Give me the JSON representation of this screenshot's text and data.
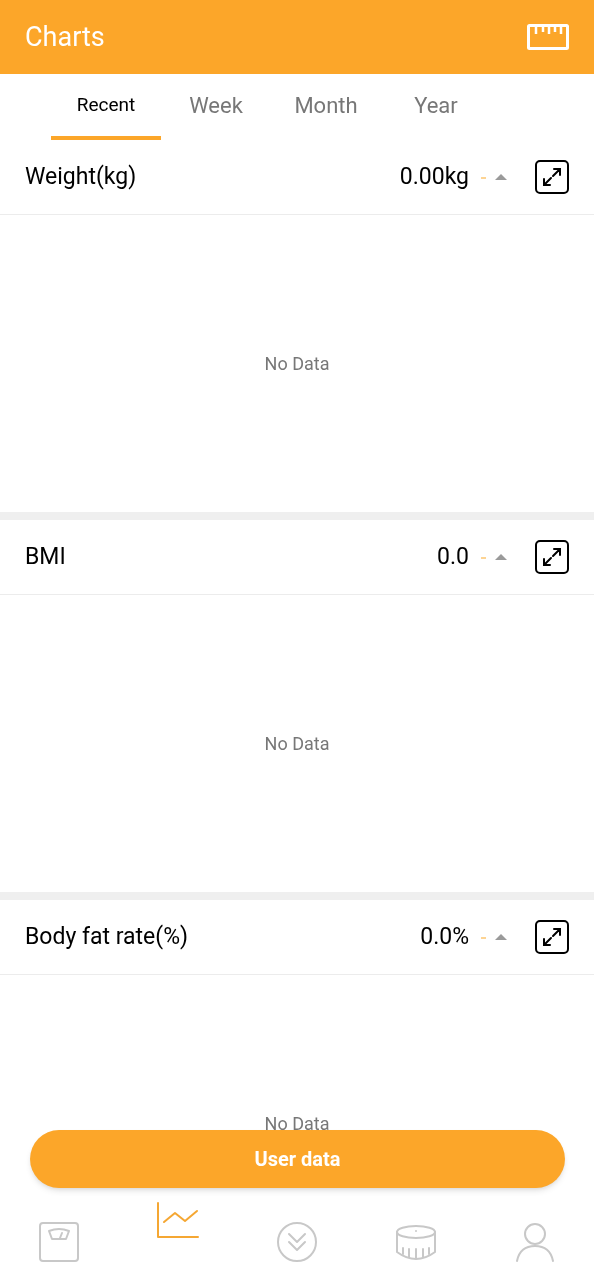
{
  "app_bar": {
    "title": "Charts"
  },
  "tabs": [
    {
      "label": "Recent",
      "selected": true
    },
    {
      "label": "Week",
      "selected": false
    },
    {
      "label": "Month",
      "selected": false
    },
    {
      "label": "Year",
      "selected": false
    }
  ],
  "charts": [
    {
      "title": "Weight(kg)",
      "value": "0.00kg",
      "empty_text": "No Data"
    },
    {
      "title": "BMI",
      "value": "0.0",
      "empty_text": "No Data"
    },
    {
      "title": "Body fat rate(%)",
      "value": "0.0%",
      "empty_text": "No Data"
    }
  ],
  "user_data_button": "User data",
  "bottom_nav": [
    {
      "kind": "scale",
      "selected": false
    },
    {
      "kind": "chart",
      "selected": true
    },
    {
      "kind": "download",
      "selected": false
    },
    {
      "kind": "tape",
      "selected": false
    },
    {
      "kind": "profile",
      "selected": false
    }
  ]
}
